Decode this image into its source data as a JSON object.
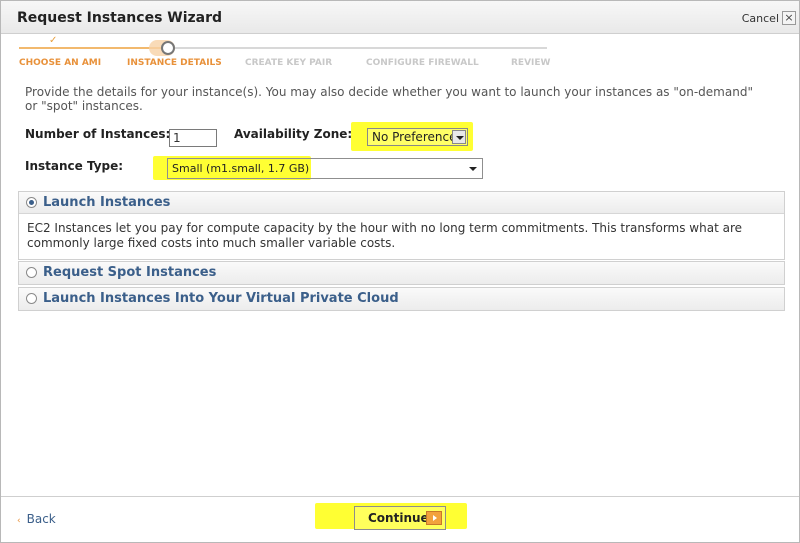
{
  "dialog": {
    "title": "Request Instances Wizard",
    "cancel_label": "Cancel",
    "close_glyph": "×"
  },
  "steps": [
    {
      "label": "CHOOSE AN AMI",
      "state": "done"
    },
    {
      "label": "INSTANCE DETAILS",
      "state": "current"
    },
    {
      "label": "CREATE KEY PAIR",
      "state": "future"
    },
    {
      "label": "CONFIGURE FIREWALL",
      "state": "future"
    },
    {
      "label": "REVIEW",
      "state": "future"
    }
  ],
  "intro_text": "Provide the details for your instance(s). You may also decide whether you want to launch your instances as \"on-demand\" or \"spot\" instances.",
  "form": {
    "num_instances_label": "Number of Instances:",
    "num_instances_value": "1",
    "availability_zone_label": "Availability Zone:",
    "availability_zone_value": "No Preference",
    "instance_type_label": "Instance Type:",
    "instance_type_value": "Small (m1.small, 1.7 GB)"
  },
  "options": [
    {
      "title": "Launch Instances",
      "selected": true,
      "body": "EC2 Instances let you pay for compute capacity by the hour with no long term commitments. This transforms what are commonly large fixed costs into much smaller variable costs."
    },
    {
      "title": "Request Spot Instances",
      "selected": false
    },
    {
      "title": "Launch Instances Into Your Virtual Private Cloud",
      "selected": false
    }
  ],
  "footer": {
    "back_label": "Back",
    "back_glyph": "‹",
    "continue_label": "Continue"
  },
  "colors": {
    "highlight": "#ffff33",
    "step_active": "#e8913a",
    "link": "#3b5f8a"
  }
}
